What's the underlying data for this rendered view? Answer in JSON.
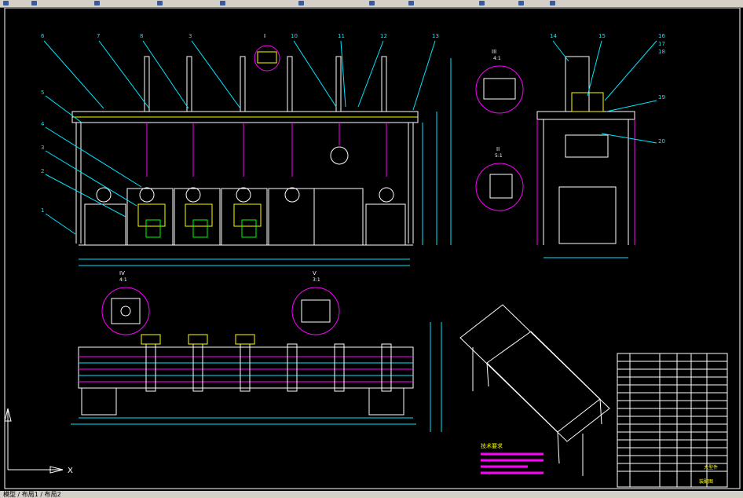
{
  "app": {
    "window": "CAD drawing viewport"
  },
  "toolbar": {
    "icons": [
      "new-icon",
      "open-icon",
      "save-icon",
      "print-icon",
      "cut-icon",
      "copy-icon",
      "paste-icon",
      "undo-icon",
      "redo-icon",
      "pan-icon",
      "zoom-icon",
      "properties-icon",
      "layers-icon",
      "help-icon"
    ]
  },
  "tabs": {
    "label": "模型 / 布局1 / 布局2"
  },
  "drawing": {
    "callouts_top": [
      "6",
      "7",
      "8",
      "3",
      "I",
      "10",
      "11",
      "12",
      "13"
    ],
    "callouts_right": [
      "14",
      "15",
      "16",
      "17",
      "18",
      "19",
      "20"
    ],
    "callouts_left": [
      "5",
      "4",
      "3",
      "2",
      "1"
    ],
    "section_labels": [
      "III",
      "II",
      "IV",
      "V"
    ],
    "section_scales": [
      "4:1",
      "5:1",
      "4:1",
      "3:1"
    ],
    "plan_labels": [
      "IV",
      "V",
      "20"
    ],
    "title_block": {
      "name": "大型件",
      "sheet": "装配图"
    },
    "notes_title": "技术要求"
  },
  "colors": {
    "cyan": "#00e5ff",
    "yellow": "#ffff00",
    "magenta": "#ff00ff",
    "white": "#ffffff",
    "green": "#00ff00",
    "red": "#ff3030"
  }
}
